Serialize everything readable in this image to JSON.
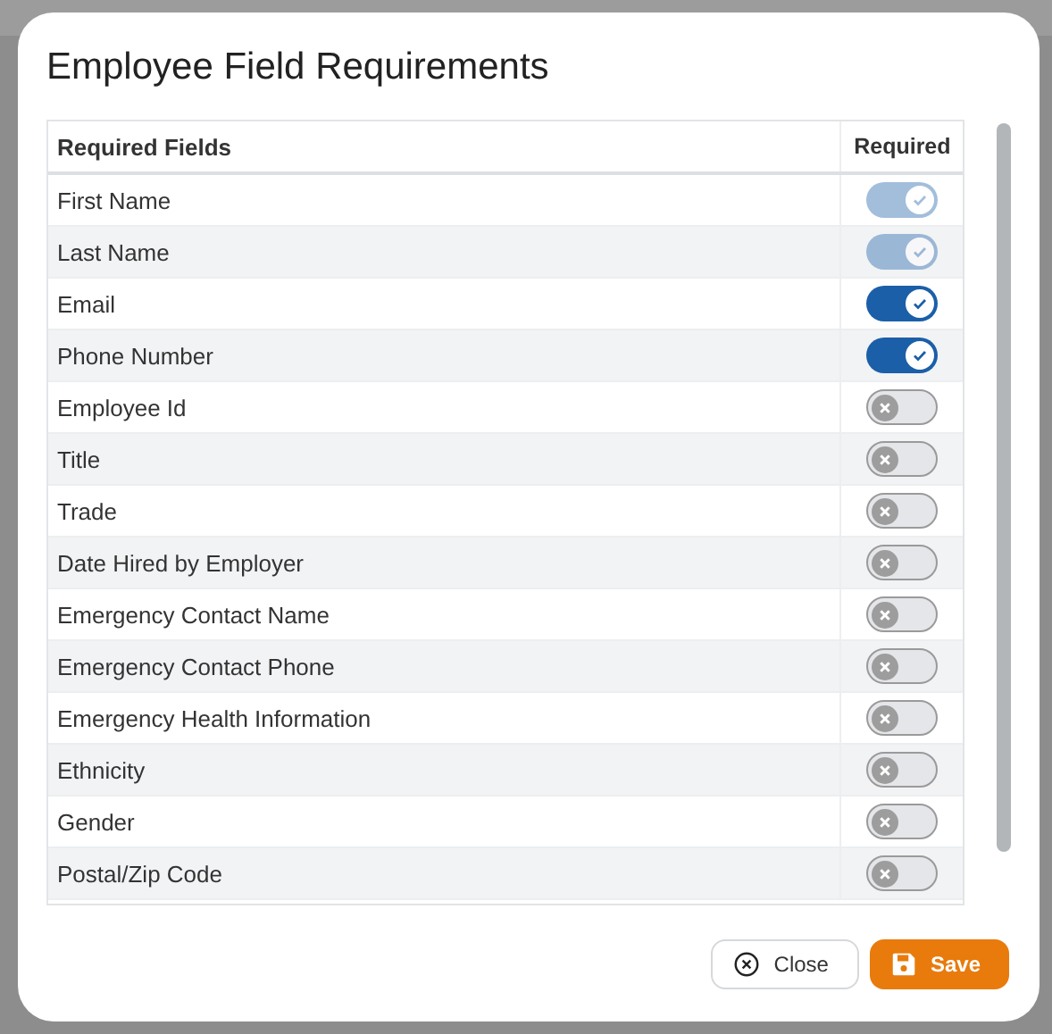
{
  "dialog": {
    "title": "Employee Field Requirements",
    "table": {
      "columns": [
        "Required Fields",
        "Required"
      ],
      "rows": [
        {
          "label": "First Name",
          "checked": true,
          "disabled": true
        },
        {
          "label": "Last Name",
          "checked": true,
          "disabled": true
        },
        {
          "label": "Email",
          "checked": true,
          "disabled": false
        },
        {
          "label": "Phone Number",
          "checked": true,
          "disabled": false
        },
        {
          "label": "Employee Id",
          "checked": false,
          "disabled": false
        },
        {
          "label": "Title",
          "checked": false,
          "disabled": false
        },
        {
          "label": "Trade",
          "checked": false,
          "disabled": false
        },
        {
          "label": "Date Hired by Employer",
          "checked": false,
          "disabled": false
        },
        {
          "label": "Emergency Contact Name",
          "checked": false,
          "disabled": false
        },
        {
          "label": "Emergency Contact Phone",
          "checked": false,
          "disabled": false
        },
        {
          "label": "Emergency Health Information",
          "checked": false,
          "disabled": false
        },
        {
          "label": "Ethnicity",
          "checked": false,
          "disabled": false
        },
        {
          "label": "Gender",
          "checked": false,
          "disabled": false
        },
        {
          "label": "Postal/Zip Code",
          "checked": false,
          "disabled": false
        }
      ]
    },
    "buttons": [
      {
        "kind": "close",
        "label": "Close"
      },
      {
        "kind": "save",
        "label": "Save"
      }
    ]
  }
}
